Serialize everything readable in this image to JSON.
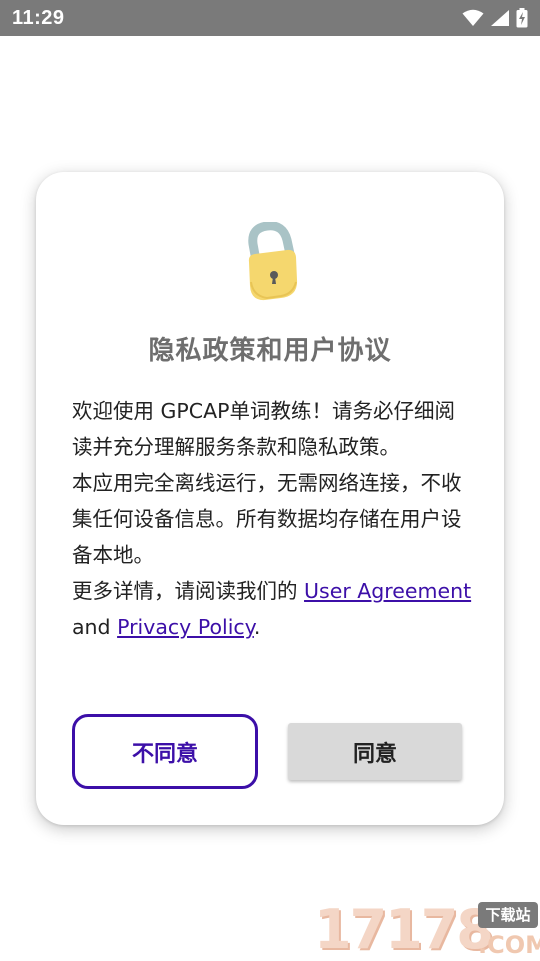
{
  "status_bar": {
    "time": "11:29",
    "icons": [
      "wifi-icon",
      "cell-signal-icon",
      "battery-charging-icon"
    ]
  },
  "dialog": {
    "icon": "lock-icon",
    "title": "隐私政策和用户协议",
    "paragraph1": "欢迎使用 GPCAP单词教练！请务必仔细阅读并充分理解服务条款和隐私政策。",
    "paragraph2": "本应用完全离线运行，无需网络连接，不收集任何设备信息。所有数据均存储在用户设备本地。",
    "paragraph3_prefix": "更多详情，请阅读我们的 ",
    "user_agreement_link": "User Agreement",
    "and_text": " and ",
    "privacy_policy_link": "Privacy Policy",
    "period": ".",
    "decline_label": "不同意",
    "agree_label": "同意"
  },
  "watermark": {
    "digits": "17178",
    "tag": "下载站",
    "domain": ".COM"
  },
  "colors": {
    "accent": "#3c0fa8",
    "status_bar": "#7a7a7a",
    "agree_bg": "#d9d9d9"
  }
}
